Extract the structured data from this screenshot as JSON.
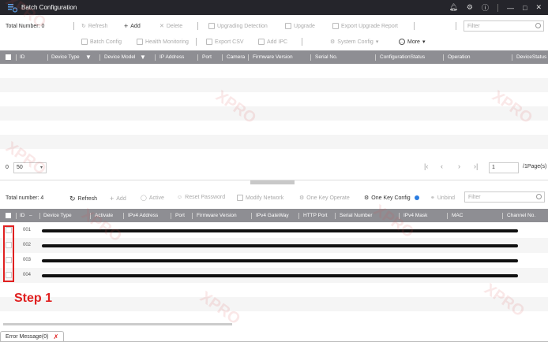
{
  "window": {
    "title": "Batch Configuration",
    "controls": [
      "bell-icon",
      "gear-icon",
      "info-icon",
      "minimize-icon",
      "maximize-icon",
      "close-icon"
    ]
  },
  "upper": {
    "total_label": "Total Number: 0",
    "toolbar_row1": [
      {
        "label": "Refresh",
        "enabled": false
      },
      {
        "label": "Add",
        "enabled": true
      },
      {
        "label": "Delete",
        "enabled": false
      },
      {
        "label": "Upgrading Detection",
        "enabled": false
      },
      {
        "label": "Upgrade",
        "enabled": false
      },
      {
        "label": "Export Upgrade Report",
        "enabled": false
      }
    ],
    "toolbar_row2": [
      {
        "label": "Batch Config",
        "enabled": false
      },
      {
        "label": "Health Monitoring",
        "enabled": false
      },
      {
        "label": "Export CSV",
        "enabled": false
      },
      {
        "label": "Add IPC",
        "enabled": false
      },
      {
        "label": "System Config",
        "enabled": false
      },
      {
        "label": "More",
        "enabled": true
      }
    ],
    "filter_placeholder": "Filter",
    "columns": [
      "ID",
      "Device Type",
      "Device Model",
      "IP Address",
      "Port",
      "Camera",
      "Firmware Version",
      "Serial No.",
      "ConfigurationStatus",
      "Operation",
      "DeviceStatus"
    ]
  },
  "pager": {
    "page_size": "50",
    "current_page": "1",
    "total_pages": "/1Page(s)"
  },
  "lower": {
    "total_label": "Total number: 4",
    "toolbar": [
      {
        "label": "Refresh",
        "enabled": true
      },
      {
        "label": "Add",
        "enabled": false
      },
      {
        "label": "Active",
        "enabled": false
      },
      {
        "label": "Reset Password",
        "enabled": false
      },
      {
        "label": "Modify Network",
        "enabled": false
      },
      {
        "label": "One Key Operate",
        "enabled": false
      },
      {
        "label": "One Key Config",
        "enabled": true
      },
      {
        "label": "Unbind",
        "enabled": false
      }
    ],
    "filter_placeholder": "Filter",
    "columns": [
      "ID",
      "Device Type",
      "Activate",
      "IPv4 Address",
      "Port",
      "Firmware Version",
      "IPv4 GateWay",
      "HTTP Port",
      "Serial Number",
      "IPv4 Mask",
      "MAC",
      "Channel No."
    ],
    "rows": [
      {
        "id": "001"
      },
      {
        "id": "002"
      },
      {
        "id": "003"
      },
      {
        "id": "004"
      }
    ]
  },
  "annotation": {
    "step_label": "Step 1",
    "color": "#e02020"
  },
  "bottom_tab": {
    "label": "Error Message(0)"
  },
  "watermark": "XPRO"
}
